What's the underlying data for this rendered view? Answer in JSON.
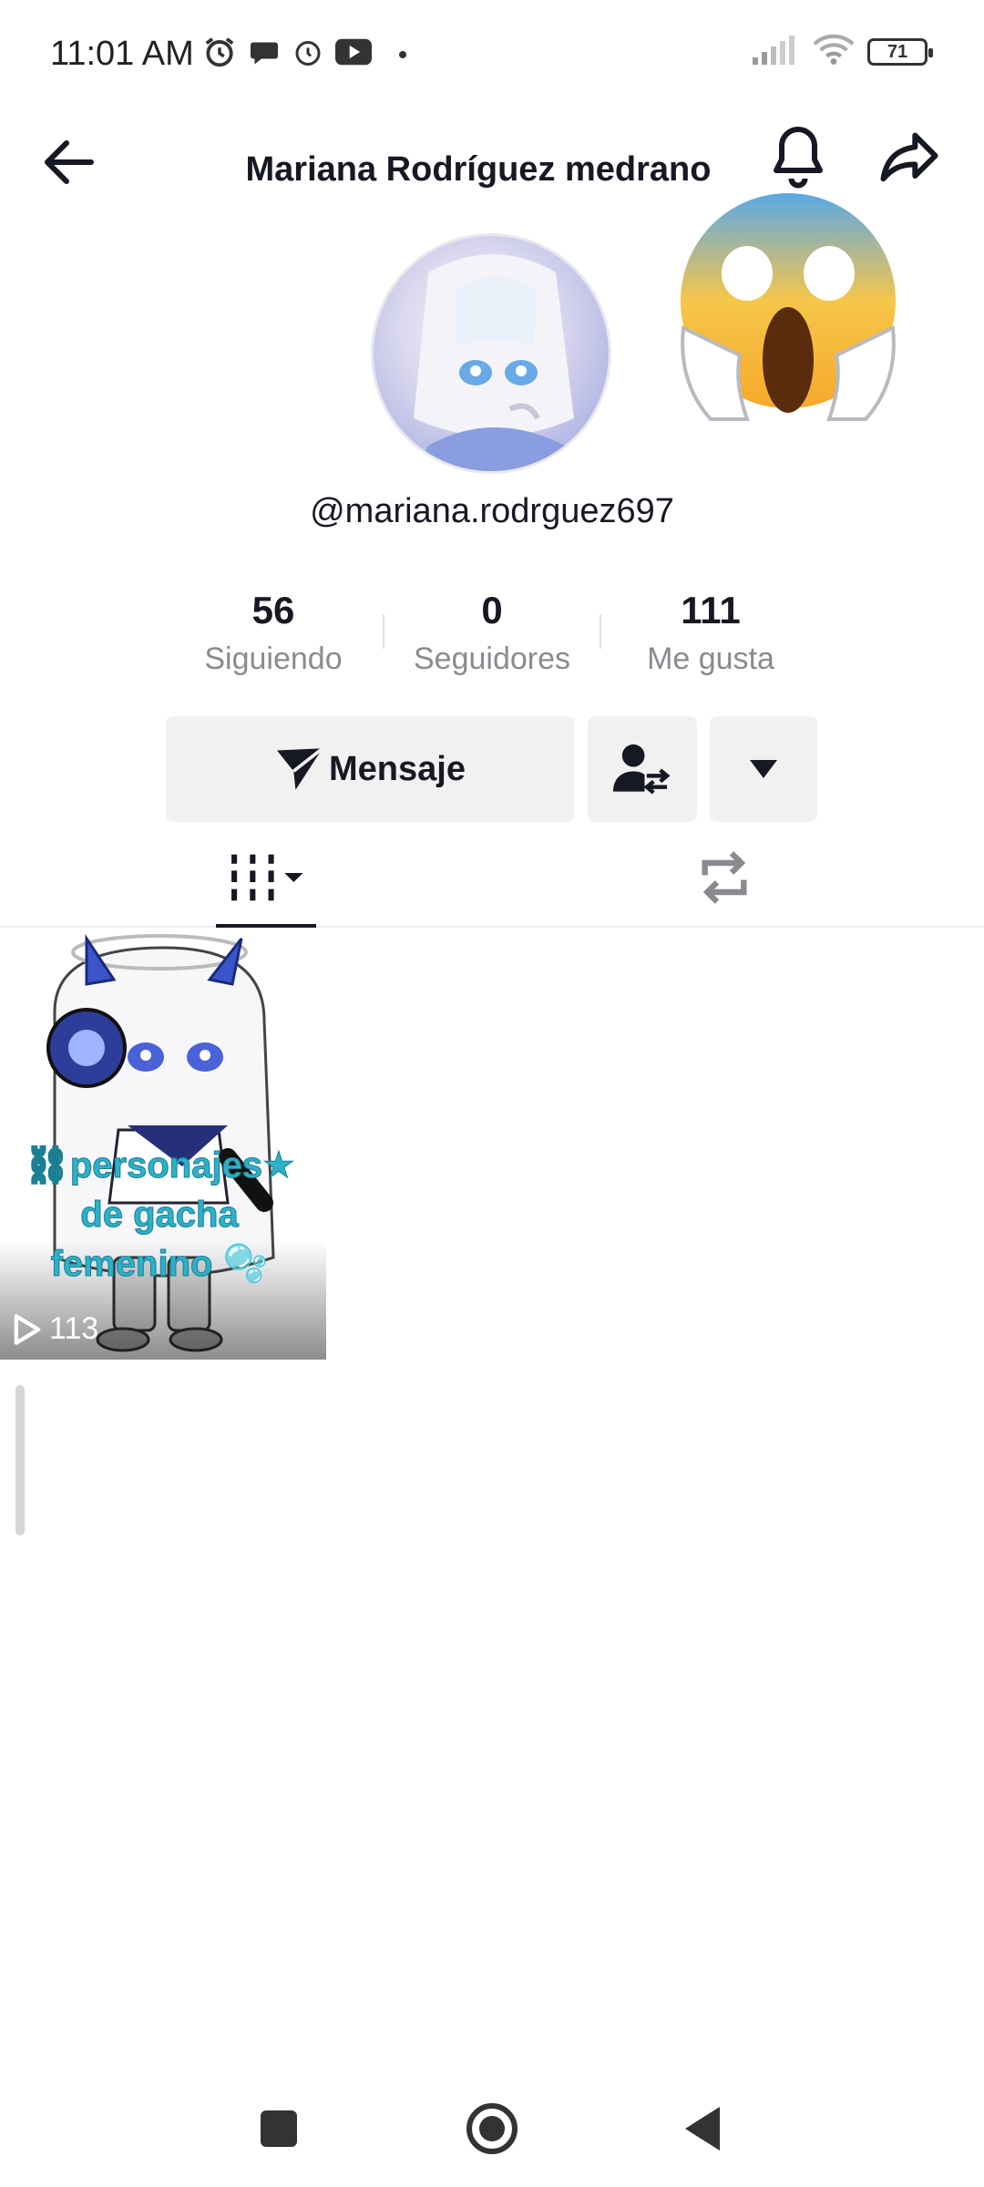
{
  "status_bar": {
    "time": "11:01 AM",
    "battery": "71",
    "icons": [
      "alarm-icon",
      "chat-bubble-icon",
      "alarm-clock-icon",
      "youtube-icon",
      "dot-icon",
      "signal-icon",
      "wifi-icon",
      "battery-icon"
    ]
  },
  "header": {
    "title": "Mariana Rodríguez medrano",
    "icons": [
      "back-arrow-icon",
      "bell-icon",
      "share-icon"
    ]
  },
  "profile": {
    "username": "@mariana.rodrguez697",
    "emoji_sticker": "face-screaming-in-fear"
  },
  "stats": [
    {
      "value": "56",
      "label": "Siguiendo"
    },
    {
      "value": "0",
      "label": "Seguidores"
    },
    {
      "value": "111",
      "label": "Me gusta"
    }
  ],
  "actions": {
    "message_label": "Mensaje",
    "icons": [
      "send-icon",
      "add-friend-swap-icon",
      "caret-down-icon"
    ]
  },
  "tabs": [
    {
      "name": "videos",
      "icon": "grid-icon",
      "active": true
    },
    {
      "name": "reposts",
      "icon": "repost-icon",
      "active": false
    }
  ],
  "videos": [
    {
      "caption": "⛓personajes★ de gacha femenino 🫧",
      "views": "113"
    }
  ],
  "nav_bar": {
    "icons": [
      "recent-apps-icon",
      "home-icon",
      "back-icon"
    ]
  },
  "colors": {
    "text": "#161823",
    "muted": "#8a8b91",
    "button_bg": "#f1f1f2",
    "caption": "#2db1c8"
  }
}
